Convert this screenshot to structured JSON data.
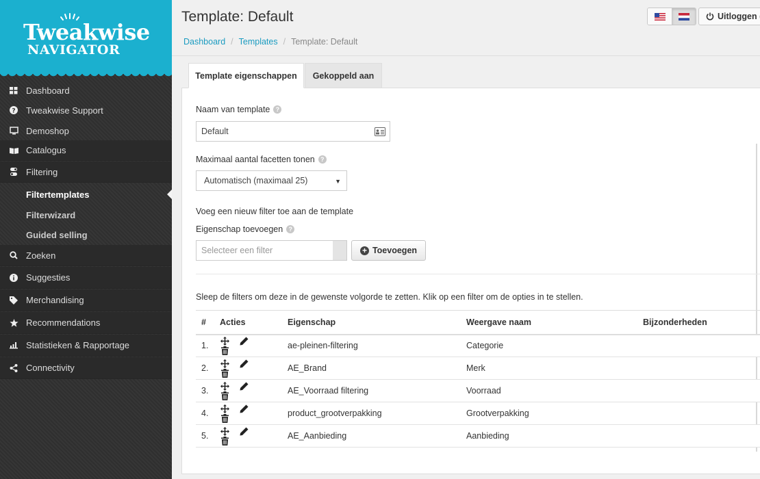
{
  "logo": {
    "title": "Tweakwise",
    "subtitle": "NAVIGATOR"
  },
  "sidebar": {
    "items": [
      {
        "label": "Dashboard",
        "icon": "dashboard-icon"
      },
      {
        "label": "Tweakwise Support",
        "icon": "question-icon"
      },
      {
        "label": "Demoshop",
        "icon": "monitor-icon"
      },
      {
        "label": "Catalogus",
        "icon": "book-icon"
      },
      {
        "label": "Filtering",
        "icon": "filter-toggle-icon"
      },
      {
        "label": "Filtertemplates",
        "active": true
      },
      {
        "label": "Filterwizard"
      },
      {
        "label": "Guided selling"
      },
      {
        "label": "Zoeken",
        "icon": "search-icon"
      },
      {
        "label": "Suggesties",
        "icon": "info-icon"
      },
      {
        "label": "Merchandising",
        "icon": "tag-icon"
      },
      {
        "label": "Recommendations",
        "icon": "star-icon"
      },
      {
        "label": "Statistieken & Rapportage",
        "icon": "bar-chart-icon"
      },
      {
        "label": "Connectivity",
        "icon": "share-icon"
      }
    ]
  },
  "header": {
    "title": "Template: Default",
    "breadcrumb": {
      "home": "Dashboard",
      "parent": "Templates",
      "current": "Template: Default",
      "sep": "/"
    },
    "logout_label": "Uitloggen ("
  },
  "tabs": [
    {
      "label": "Template eigenschappen",
      "active": true
    },
    {
      "label": "Gekoppeld aan",
      "active": false
    }
  ],
  "form": {
    "name_label": "Naam van template",
    "name_value": "Default",
    "max_facets_label": "Maximaal aantal facetten tonen",
    "max_facets_value": "Automatisch (maximaal 25)",
    "add_filter_intro": "Voeg een nieuw filter toe aan de template",
    "add_property_label": "Eigenschap toevoegen",
    "filter_placeholder": "Selecteer een filter",
    "add_button": "Toevoegen",
    "sort_hint": "Sleep de filters om deze in de gewenste volgorde te zetten. Klik op een filter om de opties in te stellen.",
    "help_glyph": "?"
  },
  "table": {
    "headers": [
      "#",
      "Acties",
      "Eigenschap",
      "Weergave naam",
      "Bijzonderheden"
    ],
    "rows": [
      {
        "num": "1.",
        "property": "ae-pleinen-filtering",
        "display": "Categorie",
        "notes": ""
      },
      {
        "num": "2.",
        "property": "AE_Brand",
        "display": "Merk",
        "notes": ""
      },
      {
        "num": "3.",
        "property": "AE_Voorraad filtering",
        "display": "Voorraad",
        "notes": ""
      },
      {
        "num": "4.",
        "property": "product_grootverpakking",
        "display": "Grootverpakking",
        "notes": ""
      },
      {
        "num": "5.",
        "property": "AE_Aanbieding",
        "display": "Aanbieding",
        "notes": ""
      }
    ]
  },
  "colors": {
    "brand": "#1bb0cf",
    "sidebar": "#333333",
    "link": "#1a9bc0"
  }
}
